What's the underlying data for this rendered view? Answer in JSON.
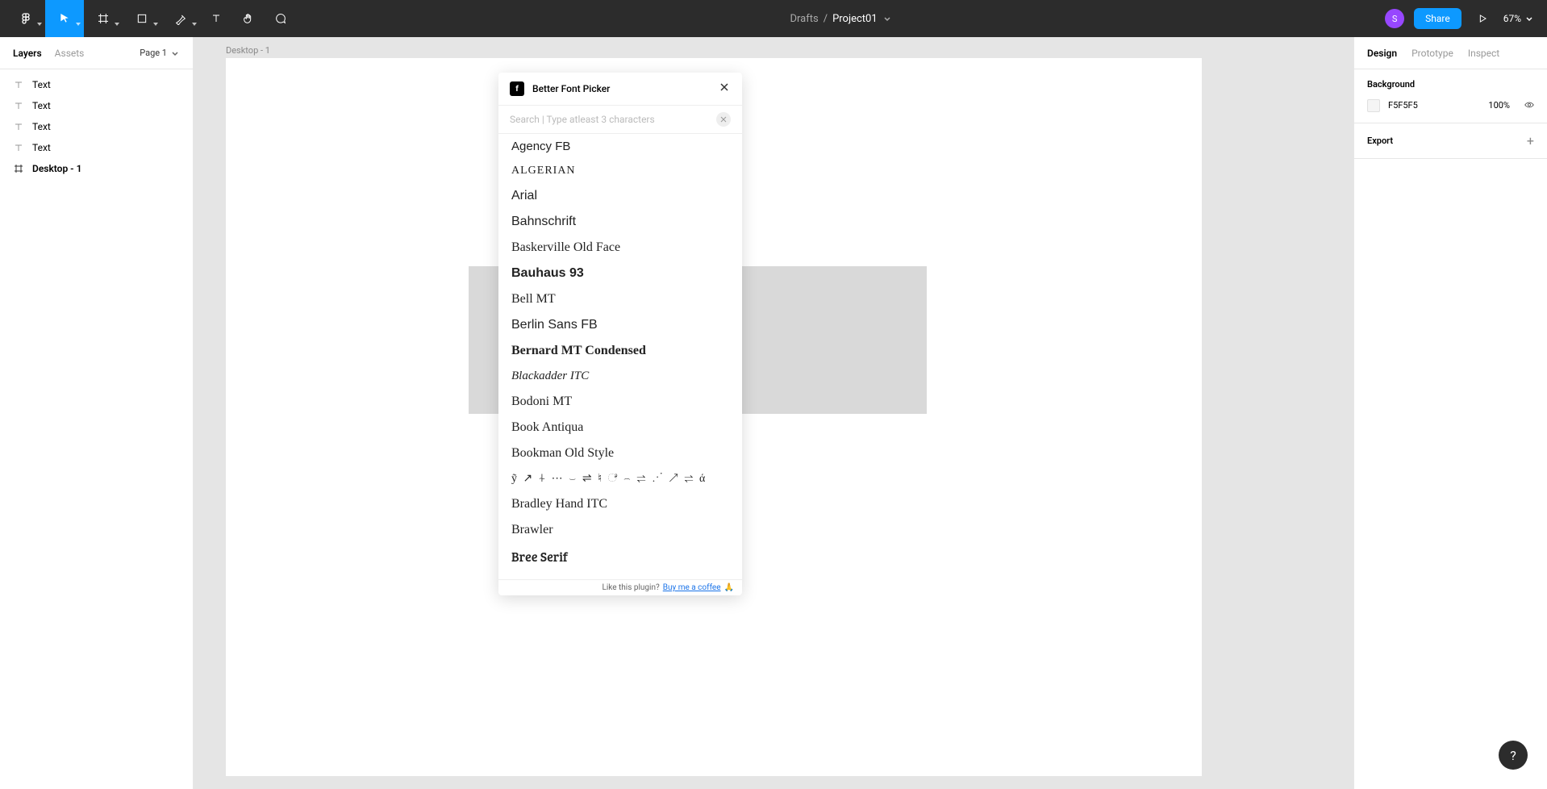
{
  "toolbar": {
    "drafts": "Drafts",
    "slash": "/",
    "project": "Project01",
    "avatar_initial": "S",
    "share": "Share",
    "zoom": "67%"
  },
  "left_panel": {
    "tabs": {
      "layers": "Layers",
      "assets": "Assets"
    },
    "page_selector": "Page 1",
    "layers": [
      {
        "type": "text",
        "label": "Text"
      },
      {
        "type": "text",
        "label": "Text"
      },
      {
        "type": "text",
        "label": "Text"
      },
      {
        "type": "text",
        "label": "Text"
      },
      {
        "type": "frame",
        "label": "Desktop - 1"
      }
    ]
  },
  "right_panel": {
    "tabs": {
      "design": "Design",
      "prototype": "Prototype",
      "inspect": "Inspect"
    },
    "background_label": "Background",
    "bg_hex": "F5F5F5",
    "bg_opacity": "100%",
    "export_label": "Export"
  },
  "canvas": {
    "frame_label": "Desktop - 1"
  },
  "plugin": {
    "title": "Better Font Picker",
    "search_placeholder": "Search | Type atleast 3 characters",
    "fonts": [
      "Agency FB",
      "ALGERIAN",
      "Arial",
      "Bahnschrift",
      "Baskerville Old Face",
      "Bauhaus 93",
      "Bell MT",
      "Berlin Sans FB",
      "Bernard MT Condensed",
      "Blackadder ITC",
      "Bodoni MT",
      "Book Antiqua",
      "Bookman Old Style",
      "ỹ ↗ ⍭ ⋯ ⌣ ⇌ ♮ ೆ ⌢ ⇌ ⋰ ↗ ⇌ ά",
      "Bradley Hand ITC",
      "Brawler",
      "Bree Serif"
    ],
    "footer_text": "Like this plugin?",
    "footer_link": "Buy me a coffee",
    "footer_emoji": "🙏"
  },
  "help": "?"
}
